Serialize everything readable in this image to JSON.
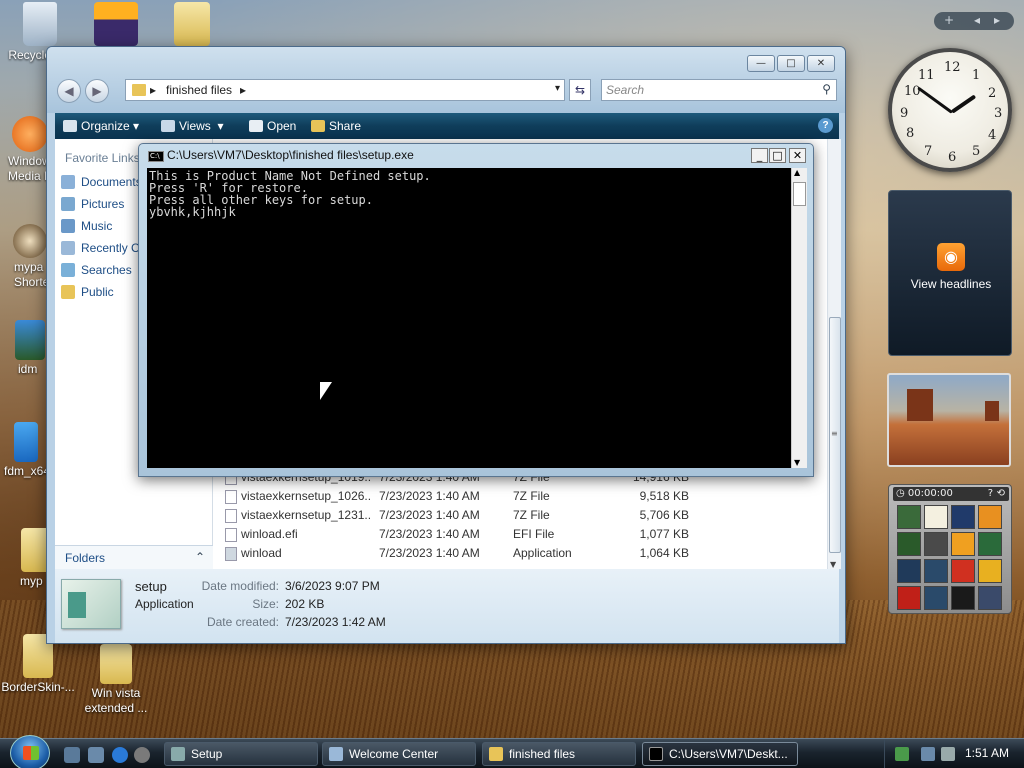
{
  "desktop": {
    "icons": [
      {
        "label": "Recycle Bin"
      },
      {
        "label": ""
      },
      {
        "label": ""
      },
      {
        "label": "Windows Media P..."
      },
      {
        "label": "mypa Shorte"
      },
      {
        "label": "idm"
      },
      {
        "label": "fdm_x64"
      },
      {
        "label": "myp"
      },
      {
        "label": "BorderSkin-..."
      },
      {
        "label": "Win vista extended ..."
      }
    ]
  },
  "explorer": {
    "address": {
      "crumb": "finished files",
      "arrow_glyph": "▸",
      "dropdown_glyph": "▾"
    },
    "search_placeholder": "Search",
    "window_buttons": {
      "min": "—",
      "max": "□",
      "close": "✕"
    },
    "toolbar": {
      "organize": "Organize",
      "views": "Views",
      "open": "Open",
      "share": "Share"
    },
    "navpane": {
      "heading": "Favorite Links",
      "links": [
        "Documents",
        "Pictures",
        "Music",
        "Recently C",
        "Searches",
        "Public"
      ],
      "folders_label": "Folders"
    },
    "files": [
      {
        "name": "vistaexkernsetup_1019...",
        "date": "7/23/2023 1:40 AM",
        "type": "7Z File",
        "size": "14,916 KB"
      },
      {
        "name": "vistaexkernsetup_1026...",
        "date": "7/23/2023 1:40 AM",
        "type": "7Z File",
        "size": "9,518 KB"
      },
      {
        "name": "vistaexkernsetup_1231...",
        "date": "7/23/2023 1:40 AM",
        "type": "7Z File",
        "size": "5,706 KB"
      },
      {
        "name": "winload.efi",
        "date": "7/23/2023 1:40 AM",
        "type": "EFI File",
        "size": "1,077 KB"
      },
      {
        "name": "winload",
        "date": "7/23/2023 1:40 AM",
        "type": "Application",
        "size": "1,064 KB"
      }
    ],
    "details": {
      "name": "setup",
      "kind": "Application",
      "date_modified_label": "Date modified:",
      "date_modified": "3/6/2023 9:07 PM",
      "size_label": "Size:",
      "size": "202 KB",
      "date_created_label": "Date created:",
      "date_created": "7/23/2023 1:42 AM"
    }
  },
  "console": {
    "title": "C:\\Users\\VM7\\Desktop\\finished files\\setup.exe",
    "icon_text": "C:\\",
    "output": "This is Product Name Not Defined setup.\nPress 'R' for restore.\nPress all other keys for setup.\nybvhk,kjhhjk"
  },
  "sidebar": {
    "top_controls": {
      "add": "+",
      "prev": "◂",
      "next": "▸"
    },
    "clock": {
      "hour": 1,
      "minute": 51,
      "numbers": [
        "12",
        "1",
        "2",
        "3",
        "4",
        "5",
        "6",
        "7",
        "8",
        "9",
        "10",
        "11"
      ]
    },
    "feed": {
      "label": "View headlines"
    },
    "puzzle": {
      "timer": "00:00:00",
      "help": "?"
    }
  },
  "taskbar": {
    "buttons": [
      {
        "label": "Setup"
      },
      {
        "label": "Welcome Center"
      },
      {
        "label": "finished files"
      },
      {
        "label": "C:\\Users\\VM7\\Deskt..."
      }
    ],
    "clock": "1:51 AM"
  },
  "colors": {
    "toolbar": "#0f3d5a",
    "link": "#1e4e86",
    "console_bg": "#000000",
    "console_fg": "#d9d9d9"
  }
}
